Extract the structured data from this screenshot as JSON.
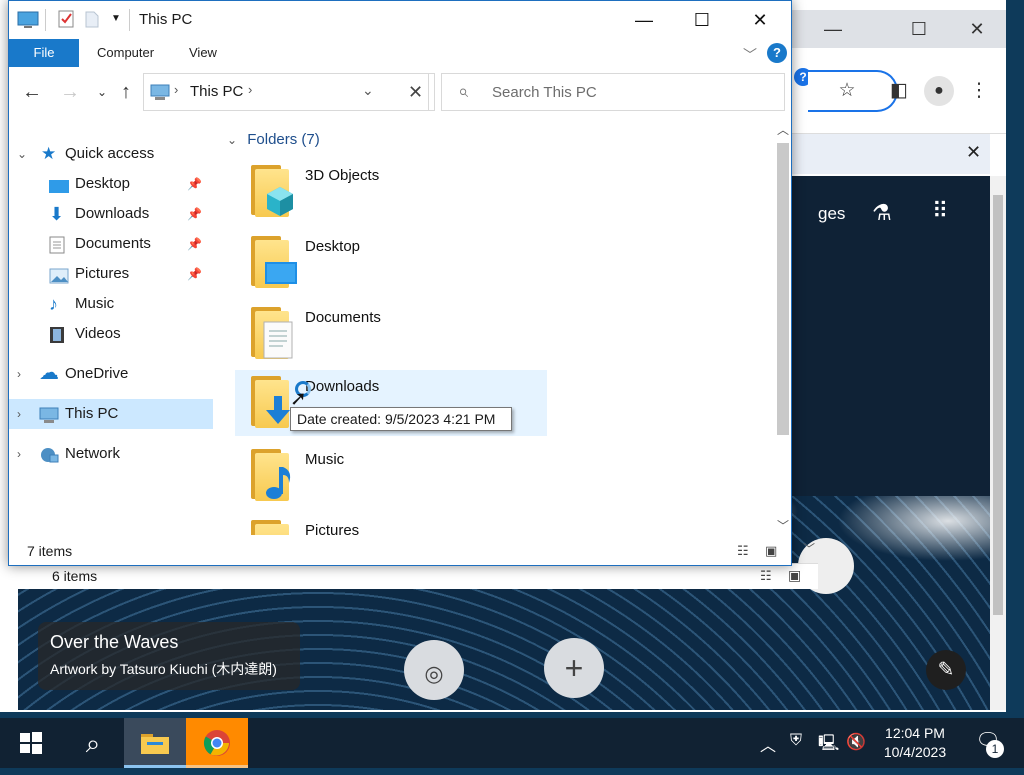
{
  "explorer": {
    "title": "This PC",
    "ribbon_tabs": {
      "file": "File",
      "computer": "Computer",
      "view": "View"
    },
    "help": "?",
    "address": {
      "location": "This PC"
    },
    "search": {
      "placeholder": "Search This PC"
    },
    "nav_pane": {
      "quick_access": "Quick access",
      "desktop": "Desktop",
      "downloads": "Downloads",
      "documents": "Documents",
      "pictures": "Pictures",
      "music": "Music",
      "videos": "Videos",
      "onedrive": "OneDrive",
      "this_pc": "This PC",
      "network": "Network"
    },
    "group_header": "Folders (7)",
    "folders": {
      "f1": "3D Objects",
      "f2": "Desktop",
      "f3": "Documents",
      "f4": "Downloads",
      "f5": "Music",
      "f6": "Pictures"
    },
    "tooltip": "Date created: 9/5/2023 4:21 PM",
    "status_items": "7 items"
  },
  "chrome_bg": {
    "status_items": "6 items",
    "ntp_fragment": "ges",
    "caption_title": "Over the Waves",
    "caption_sub": "Artwork by Tatsuro Kiuchi (木内達朗)"
  },
  "taskbar": {
    "time": "12:04 PM",
    "date": "10/4/2023",
    "notification_count": "1"
  },
  "colors": {
    "accent": "#1979ca",
    "selection": "#cce8ff",
    "hover": "#e5f3ff",
    "folder_yellow": "#f7c94f"
  }
}
